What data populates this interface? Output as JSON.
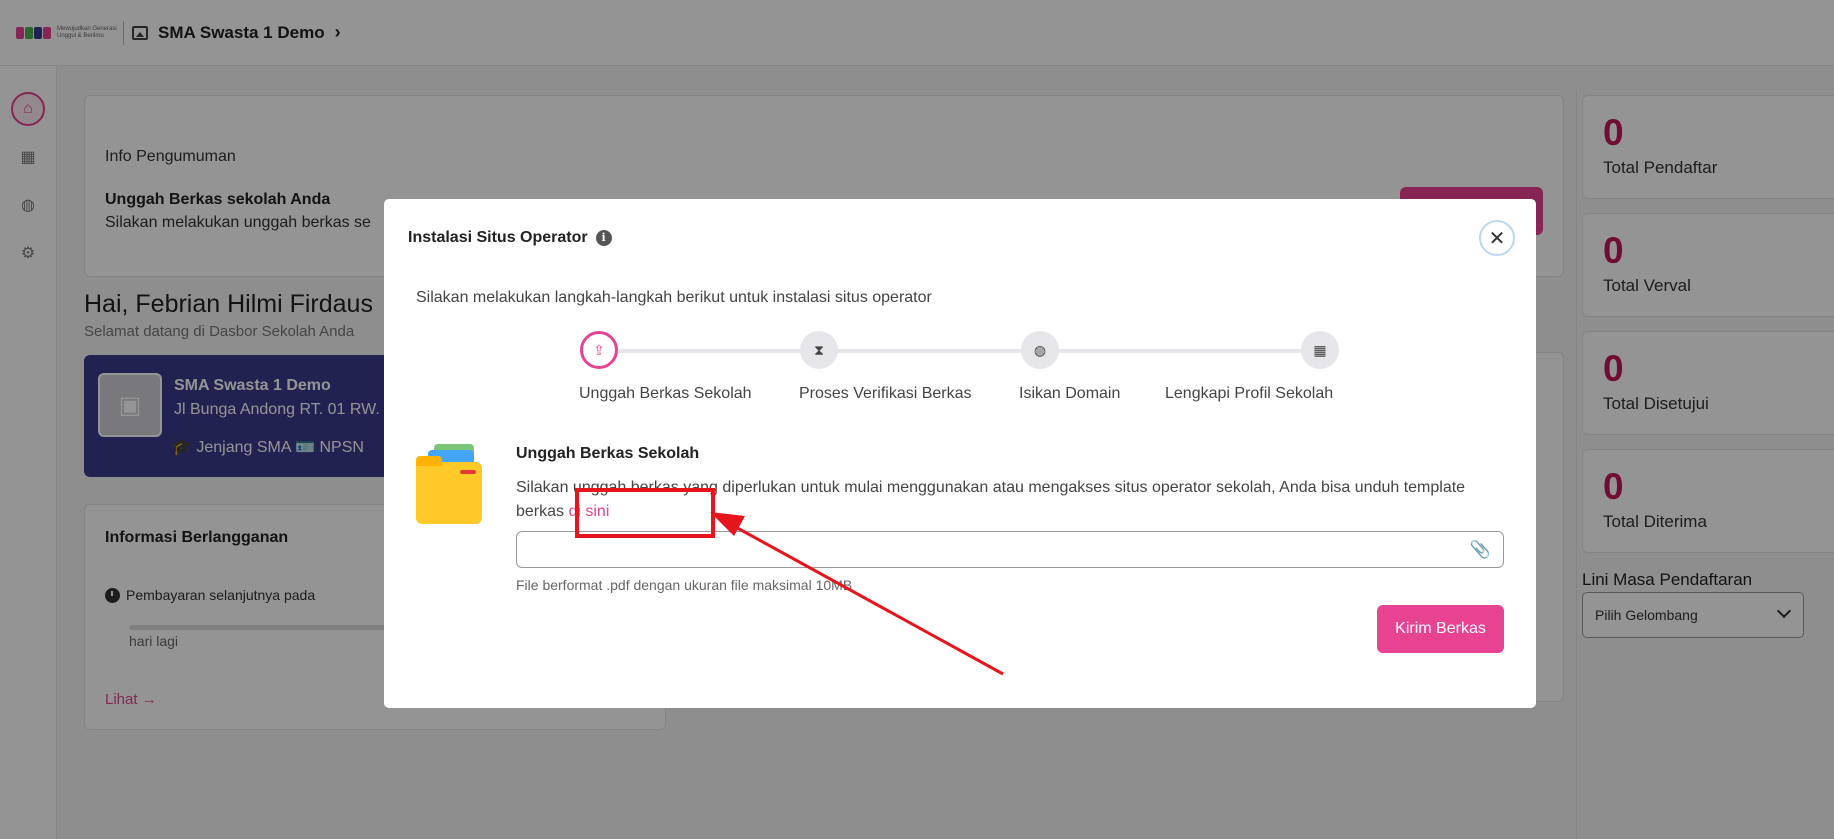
{
  "header": {
    "logo_tagline": "Mewujudkan Generasi Unggul & Berilmu",
    "school_name": "SMA Swasta 1 Demo"
  },
  "sidebar": {
    "items": [
      {
        "icon": "home-icon"
      },
      {
        "icon": "school-icon"
      },
      {
        "icon": "globe-icon"
      },
      {
        "icon": "user-settings-icon"
      }
    ]
  },
  "background": {
    "announcement": {
      "title": "Info Pengumuman",
      "subtitle": "Unggah Berkas sekolah Anda",
      "description": "Silakan melakukan unggah berkas se"
    },
    "greeting": "Hai, Febrian Hilmi Firdaus",
    "greeting_sub": "Selamat datang di Dasbor Sekolah Anda",
    "school_card": {
      "name": "SMA Swasta 1 Demo",
      "address": "Jl Bunga Andong RT. 01 RW.",
      "meta": "🎓 Jenjang SMA 🪪 NPSN"
    },
    "subscription": {
      "title": "Informasi Berlangganan",
      "next_payment": "Pembayaran selanjutnya pada",
      "days_left": "hari lagi",
      "link": "Lihat →"
    }
  },
  "stats": [
    {
      "value": "0",
      "label": "Total Pendaftar"
    },
    {
      "value": "0",
      "label": "Total Verval"
    },
    {
      "value": "0",
      "label": "Total Disetujui"
    },
    {
      "value": "0",
      "label": "Total Diterima"
    }
  ],
  "timeline": {
    "title": "Lini Masa Pendaftaran",
    "select_value": "Pilih Gelombang"
  },
  "modal": {
    "title": "Instalasi Situs Operator",
    "intro": "Silakan melakukan langkah-langkah berikut untuk instalasi situs operator",
    "steps": [
      {
        "label": "Unggah Berkas Sekolah",
        "icon": "file-upload-icon",
        "active": true
      },
      {
        "label": "Proses Verifikasi Berkas",
        "icon": "hourglass-icon",
        "active": false
      },
      {
        "label": "Isikan Domain",
        "icon": "globe-icon",
        "active": false
      },
      {
        "label": "Lengkapi Profil Sekolah",
        "icon": "school-icon",
        "active": false
      }
    ],
    "upload": {
      "title": "Unggah Berkas Sekolah",
      "description": "Silakan unggah berkas yang diperlukan untuk mulai menggunakan atau mengakses situs operator sekolah, Anda bisa unduh template berkas ",
      "link": "di sini",
      "input_value": "",
      "hint": "File berformat .pdf dengan ukuran file maksimal 10MB",
      "submit": "Kirim Berkas"
    }
  },
  "colors": {
    "accent": "#e84393",
    "stat_number": "#c2185b",
    "school_card": "#3c3c8e",
    "annotation": "#e8141b"
  }
}
